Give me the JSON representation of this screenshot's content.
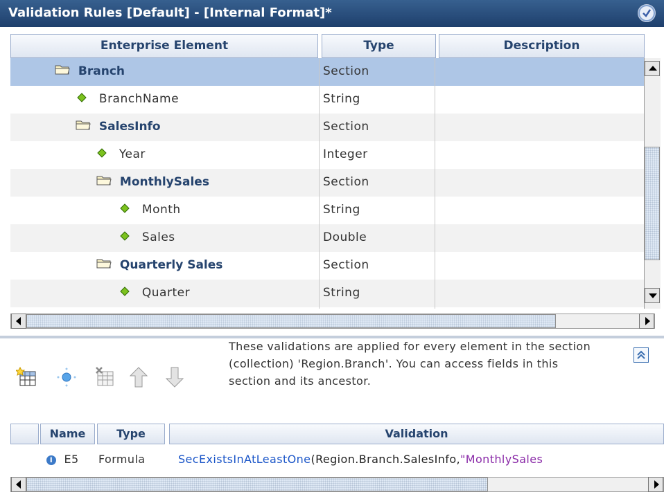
{
  "window": {
    "title": "Validation Rules [Default] - [Internal Format]*"
  },
  "grid": {
    "headers": [
      "Enterprise Element",
      "Type",
      "Description"
    ],
    "rows": [
      {
        "name": "Branch",
        "type": "Section",
        "description": "",
        "kind": "section",
        "selected": true
      },
      {
        "name": "BranchName",
        "type": "String",
        "description": "",
        "kind": "field"
      },
      {
        "name": "SalesInfo",
        "type": "Section",
        "description": "",
        "kind": "section"
      },
      {
        "name": "Year",
        "type": "Integer",
        "description": "",
        "kind": "field"
      },
      {
        "name": "MonthlySales",
        "type": "Section",
        "description": "",
        "kind": "section"
      },
      {
        "name": "Month",
        "type": "String",
        "description": "",
        "kind": "field"
      },
      {
        "name": "Sales",
        "type": "Double",
        "description": "",
        "kind": "field"
      },
      {
        "name": "Quarterly Sales",
        "type": "Section",
        "description": "",
        "kind": "section"
      },
      {
        "name": "Quarter",
        "type": "String",
        "description": "",
        "kind": "field"
      }
    ]
  },
  "toolbar": {
    "icons": [
      "add-rule-icon",
      "add-field-icon",
      "delete-rule-icon",
      "move-up-icon",
      "move-down-icon"
    ]
  },
  "info": {
    "text": "These validations are applied for every element in the section (collection) 'Region.Branch'. You can access fields in this section and its ancestor."
  },
  "validation_grid": {
    "headers": [
      "Name",
      "Type",
      "Validation"
    ],
    "rows": [
      {
        "name": "E5",
        "type": "Formula",
        "validation_func": "SecExistsInAtLeastOne",
        "validation_args": "(Region.Branch.SalesInfo,",
        "validation_string": "\"MonthlySales"
      }
    ]
  },
  "colors": {
    "title_bg": "#2a4c7d",
    "header_text": "#26446e",
    "selected_row": "#aec6e6",
    "field_diamond": "#3f8a00",
    "formula_func": "#1a55c8",
    "formula_string": "#8a2aa8"
  }
}
